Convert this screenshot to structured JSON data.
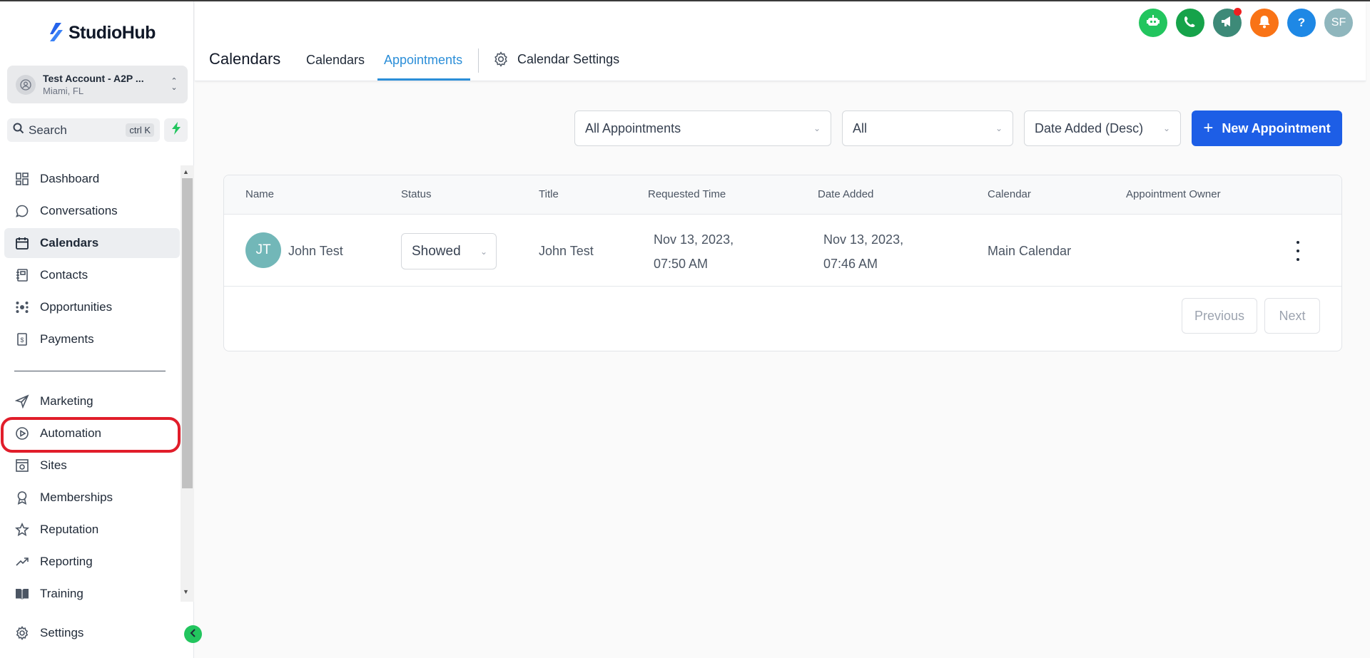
{
  "brand": {
    "name": "StudioHub"
  },
  "account": {
    "name": "Test Account - A2P ...",
    "location": "Miami, FL"
  },
  "search": {
    "label": "Search",
    "shortcut": "ctrl K"
  },
  "sidebar": {
    "items": [
      {
        "label": "Dashboard",
        "icon": "dashboard-icon"
      },
      {
        "label": "Conversations",
        "icon": "chat-bubble-icon"
      },
      {
        "label": "Calendars",
        "icon": "calendar-icon",
        "active": true
      },
      {
        "label": "Contacts",
        "icon": "contacts-book-icon"
      },
      {
        "label": "Opportunities",
        "icon": "opportunities-icon"
      },
      {
        "label": "Payments",
        "icon": "payments-icon"
      },
      {
        "label": "Marketing",
        "icon": "paper-plane-icon"
      },
      {
        "label": "Automation",
        "icon": "automation-icon"
      },
      {
        "label": "Sites",
        "icon": "sites-icon"
      },
      {
        "label": "Memberships",
        "icon": "award-icon"
      },
      {
        "label": "Reputation",
        "icon": "star-icon"
      },
      {
        "label": "Reporting",
        "icon": "trend-icon"
      },
      {
        "label": "Training",
        "icon": "book-icon"
      }
    ],
    "settings_label": "Settings"
  },
  "header": {
    "title": "Calendars",
    "tabs": [
      {
        "label": "Calendars"
      },
      {
        "label": "Appointments",
        "active": true
      },
      {
        "label": "Calendar Settings"
      }
    ],
    "user_initials": "SF"
  },
  "filters": {
    "type": "All Appointments",
    "status": "All",
    "sort": "Date Added (Desc)",
    "new_button": "New Appointment"
  },
  "table": {
    "columns": [
      "Name",
      "Status",
      "Title",
      "Requested Time",
      "Date Added",
      "Calendar",
      "Appointment Owner"
    ],
    "rows": [
      {
        "initials": "JT",
        "name": "John Test",
        "status": "Showed",
        "title": "John Test",
        "requested_date": "Nov 13, 2023,",
        "requested_time": "07:50 AM",
        "added_date": "Nov 13, 2023,",
        "added_time": "07:46 AM",
        "calendar": "Main Calendar",
        "owner": ""
      }
    ]
  },
  "pagination": {
    "previous": "Previous",
    "next": "Next"
  },
  "colors": {
    "accent": "#2b8ed8",
    "primary_button": "#1d5ee6",
    "highlight_outline": "#e11d2a",
    "avatar": "#72b7b8"
  }
}
